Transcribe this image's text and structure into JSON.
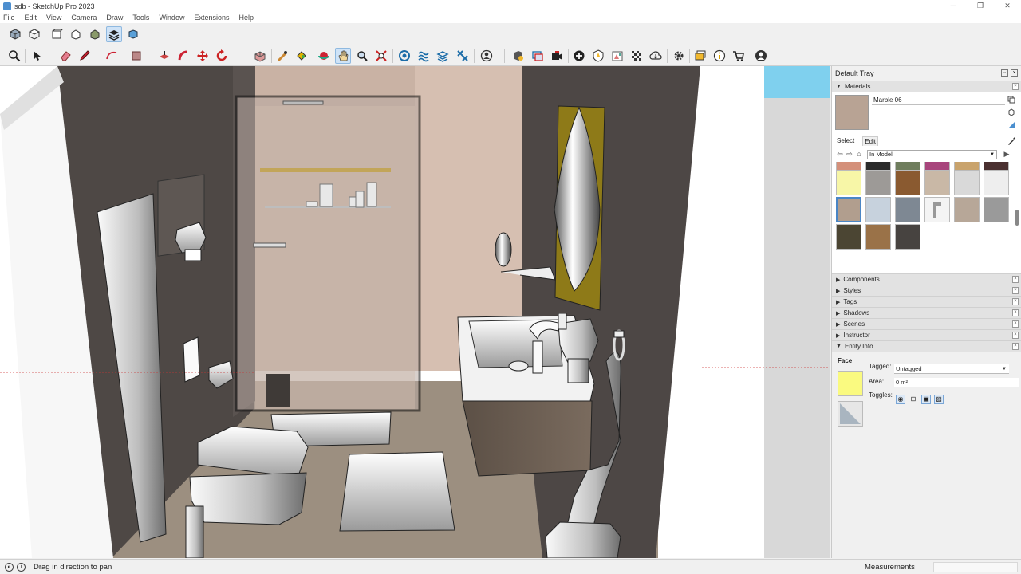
{
  "window": {
    "title": "sdb - SketchUp Pro 2023"
  },
  "window_controls": {
    "minimize": "─",
    "maximize": "❐",
    "close": "✕"
  },
  "menu": [
    "File",
    "Edit",
    "View",
    "Camera",
    "Draw",
    "Tools",
    "Window",
    "Extensions",
    "Help"
  ],
  "toolbar": {
    "views": [
      "iso-view-icon",
      "top-view-icon",
      "front-view-icon",
      "right-view-icon",
      "back-view-icon",
      "left-view-icon",
      "bottom-view-icon"
    ],
    "tools": [
      "zoom-icon",
      "select-icon",
      "eraser-icon",
      "pencil-icon",
      "arc-icon",
      "rectangle-icon",
      "push-pull-icon",
      "follow-me-icon",
      "move-icon",
      "rotate-icon",
      "scale-icon",
      "tape-measure-icon",
      "paint-bucket-icon",
      "orbit-icon",
      "pan-icon",
      "zoom-tool-icon",
      "zoom-extents-icon",
      "section-icon",
      "sandbox-icon",
      "layout-icon",
      "account-icon",
      "components-icon",
      "styles-icon",
      "scenes-icon",
      "add-location-icon",
      "photo-texture-icon",
      "match-photo-icon",
      "checker-icon",
      "cloud-icon",
      "settings-icon",
      "message-icon",
      "info-icon",
      "cart-icon",
      "profile-icon"
    ]
  },
  "tray": {
    "title": "Default Tray",
    "materials": {
      "label": "Materials",
      "current": "Marble 06",
      "tab_select": "Select",
      "tab_edit": "Edit",
      "library": "In Model",
      "swatches_row0": [
        "#d4907a",
        "#2b2b2b",
        "#6f7d5d",
        "#a8457c",
        "#c9a36c",
        "#4a3030"
      ],
      "swatches_row1": [
        "#f7f6a7",
        "#9d9a97",
        "#8a5a30",
        "#c9b8a6",
        "#d9d9d9",
        "#eeeeee"
      ],
      "swatches_row2": [
        "#b19e8e",
        "#c7d2dd",
        "#7e8893",
        "#faucet",
        "#b7a798",
        "#9a9a9a"
      ],
      "swatches_row3": [
        "#4b4533",
        "#9a7248",
        "#474340"
      ]
    },
    "panels": [
      "Components",
      "Styles",
      "Tags",
      "Shadows",
      "Scenes",
      "Instructor",
      "Entity Info"
    ],
    "entity_info": {
      "type": "Face",
      "tag_label": "Tagged:",
      "tag_value": "Untagged",
      "area_label": "Area:",
      "area_value": "0 m²",
      "toggles_label": "Toggles:"
    }
  },
  "status": {
    "hint": "Drag in direction to pan",
    "measurements_label": "Measurements"
  },
  "colors": {
    "wall_dark": "#4d4846",
    "wall_marble": "#c8b1a3",
    "floor": "#9c8f80",
    "sky": "#7fd0ee",
    "selection": "#4a86c5"
  }
}
